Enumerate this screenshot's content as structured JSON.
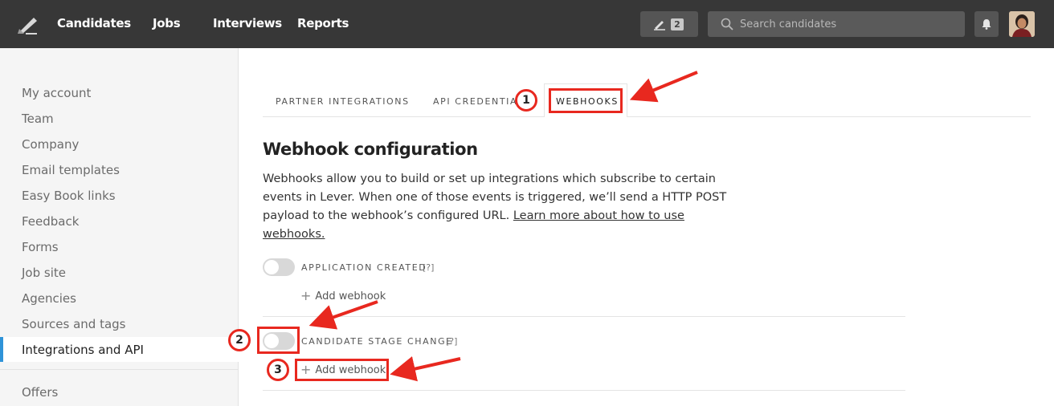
{
  "topbar": {
    "nav": [
      "Candidates",
      "Jobs",
      "Interviews",
      "Reports"
    ],
    "compose_count": "2",
    "search_placeholder": "Search candidates",
    "icons": [
      "lever-logo-icon",
      "pencil-icon",
      "search-icon",
      "bell-icon",
      "avatar"
    ]
  },
  "sidebar": {
    "items": [
      "My account",
      "Team",
      "Company",
      "Email templates",
      "Easy Book links",
      "Feedback",
      "Forms",
      "Job site",
      "Agencies",
      "Sources and tags",
      "Integrations and API",
      "Offers"
    ],
    "active": "Integrations and API"
  },
  "tabs": [
    "PARTNER INTEGRATIONS",
    "API CREDENTIALS",
    "WEBHOOKS"
  ],
  "active_tab": "WEBHOOKS",
  "main": {
    "title": "Webhook configuration",
    "description": "Webhooks allow you to build or set up integrations which subscribe to certain events in Lever. When one of those events is triggered, we’ll send a HTTP POST payload to the webhook’s configured URL. ",
    "learn_more": "Learn more about how to use webhooks.",
    "events": [
      {
        "label": "APPLICATION CREATED",
        "help": "[?]",
        "add": "Add webhook",
        "enabled": false
      },
      {
        "label": "CANDIDATE STAGE CHANGE",
        "help": "[?]",
        "add": "Add webhook",
        "enabled": false
      }
    ]
  },
  "annotations": [
    "1",
    "2",
    "3"
  ],
  "colors": {
    "topbar": "#373737",
    "accent": "#2f93d8",
    "annotation": "#e8281f"
  }
}
